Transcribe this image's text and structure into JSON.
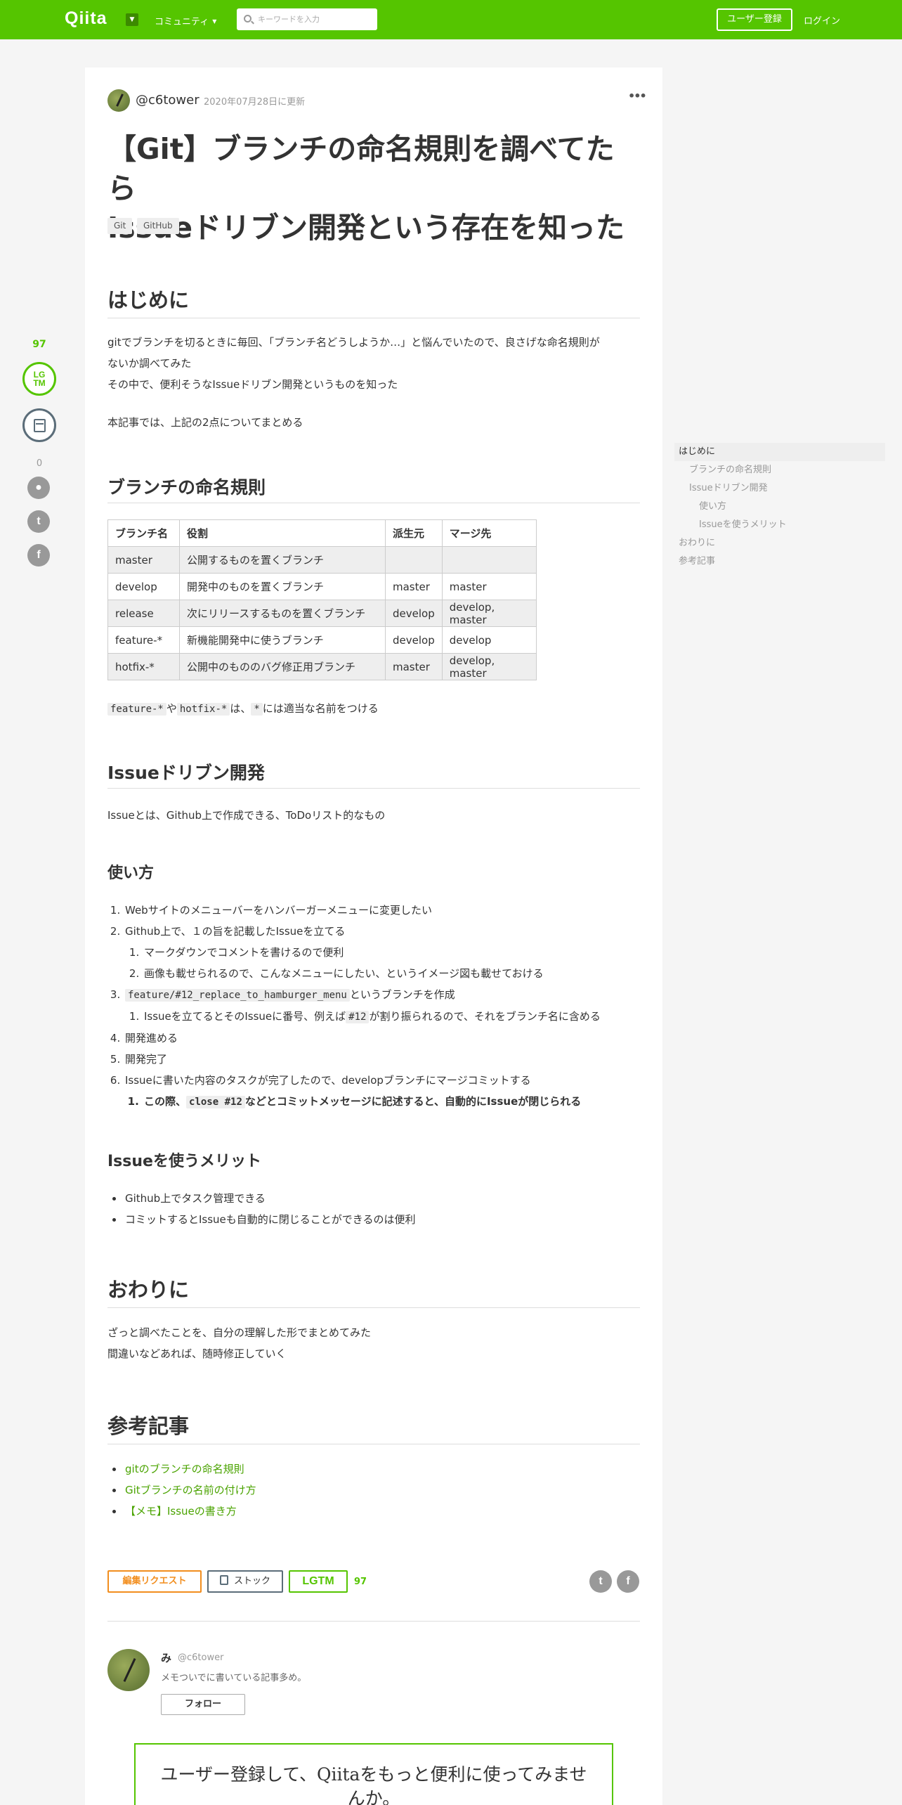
{
  "header": {
    "logo": "Qiita",
    "community": "コミュニティ",
    "search_placeholder": "キーワードを入力",
    "signup": "ユーザー登録",
    "login": "ログイン"
  },
  "rail": {
    "lgtm_count": "97",
    "lgtm_label_1": "LG",
    "lgtm_label_2": "TM",
    "comment_count": "0"
  },
  "article": {
    "author": "@c6tower",
    "updated": "2020年07月28日に更新",
    "more": "•••",
    "title_line1": "【Git】ブランチの命名規則を調べてたら",
    "title_line2": "Issueドリブン開発という存在を知った",
    "tags": [
      "Git",
      "GitHub"
    ],
    "sections": {
      "intro_heading": "はじめに",
      "intro_p1_l1": "gitでブランチを切るときに毎回、「ブランチ名どうしようか…」と悩んでいたので、良さげな命名規則が",
      "intro_p1_l2": "ないか調べてみた",
      "intro_p1_l3": "その中で、便利そうなIssueドリブン開発というものを知った",
      "intro_p2": "本記事では、上記の2点についてまとめる",
      "naming_heading": "ブランチの命名規則",
      "table": {
        "headers": [
          "ブランチ名",
          "役割",
          "派生元",
          "マージ先"
        ],
        "rows": [
          [
            "master",
            "公開するものを置くブランチ",
            "",
            ""
          ],
          [
            "develop",
            "開発中のものを置くブランチ",
            "master",
            "master"
          ],
          [
            "release",
            "次にリリースするものを置くブランチ",
            "develop",
            "develop, master"
          ],
          [
            "feature-*",
            "新機能開発中に使うブランチ",
            "develop",
            "develop"
          ],
          [
            "hotfix-*",
            "公開中のもののバグ修正用ブランチ",
            "master",
            "develop, master"
          ]
        ]
      },
      "note_code1": "feature-*",
      "note_text1": "や",
      "note_code2": "hotfix-*",
      "note_text2": "は、",
      "note_code3": "*",
      "note_text3": "には適当な名前をつける",
      "idd_heading": "Issueドリブン開発",
      "idd_p": "Issueとは、Github上で作成できる、ToDoリスト的なもの",
      "usage_heading": "使い方",
      "usage": {
        "s1": "Webサイトのメニューバーをハンバーガーメニューに変更したい",
        "s2": "Github上で、１の旨を記載したIssueを立てる",
        "s2a": "マークダウンでコメントを書けるので便利",
        "s2b": "画像も載せられるので、こんなメニューにしたい、というイメージ図も載せておける",
        "s3_code": "feature/#12_replace_to_hamburger_menu",
        "s3_text": "というブランチを作成",
        "s3a_pre": "Issueを立てるとそのIssueに番号、例えば",
        "s3a_code": "#12",
        "s3a_post": "が割り振られるので、それをブランチ名に含める",
        "s4": "開発進める",
        "s5": "開発完了",
        "s6": "Issueに書いた内容のタスクが完了したので、developブランチにマージコミットする",
        "s6a_pre": "この際、",
        "s6a_code": "close #12",
        "s6a_post": "などとコミットメッセージに記述すると、自動的にIssueが閉じられる"
      },
      "merit_heading": "Issueを使うメリット",
      "merits": [
        "Github上でタスク管理できる",
        "コミットするとIssueも自動的に閉じることができるのは便利"
      ],
      "outro_heading": "おわりに",
      "outro_l1": "ざっと調べたことを、自分の理解した形でまとめてみた",
      "outro_l2": "間違いなどあれば、随時修正していく",
      "refs_heading": "参考記事",
      "refs": [
        "gitのブランチの命名規則",
        "Gitブランチの名前の付け方",
        "【メモ】Issueの書き方"
      ]
    },
    "actions": {
      "edit": "編集リクエスト",
      "stock": "ストック",
      "lgtm": "LGTM",
      "lgtm_count": "97",
      "twitter": "t",
      "facebook": "f"
    },
    "profile": {
      "name": "み",
      "handle": "@c6tower",
      "desc": "メモついでに書いている記事多め。",
      "follow": "フォロー"
    },
    "cta": "ユーザー登録して、Qiitaをもっと便利に使ってみませんか。"
  },
  "toc": [
    "はじめに",
    "ブランチの命名規則",
    "Issueドリブン開発",
    "使い方",
    "Issueを使うメリット",
    "おわりに",
    "参考記事"
  ],
  "colors": {
    "brand": "#55c500",
    "edit": "#f28e1e",
    "stock": "#5b6d79"
  }
}
